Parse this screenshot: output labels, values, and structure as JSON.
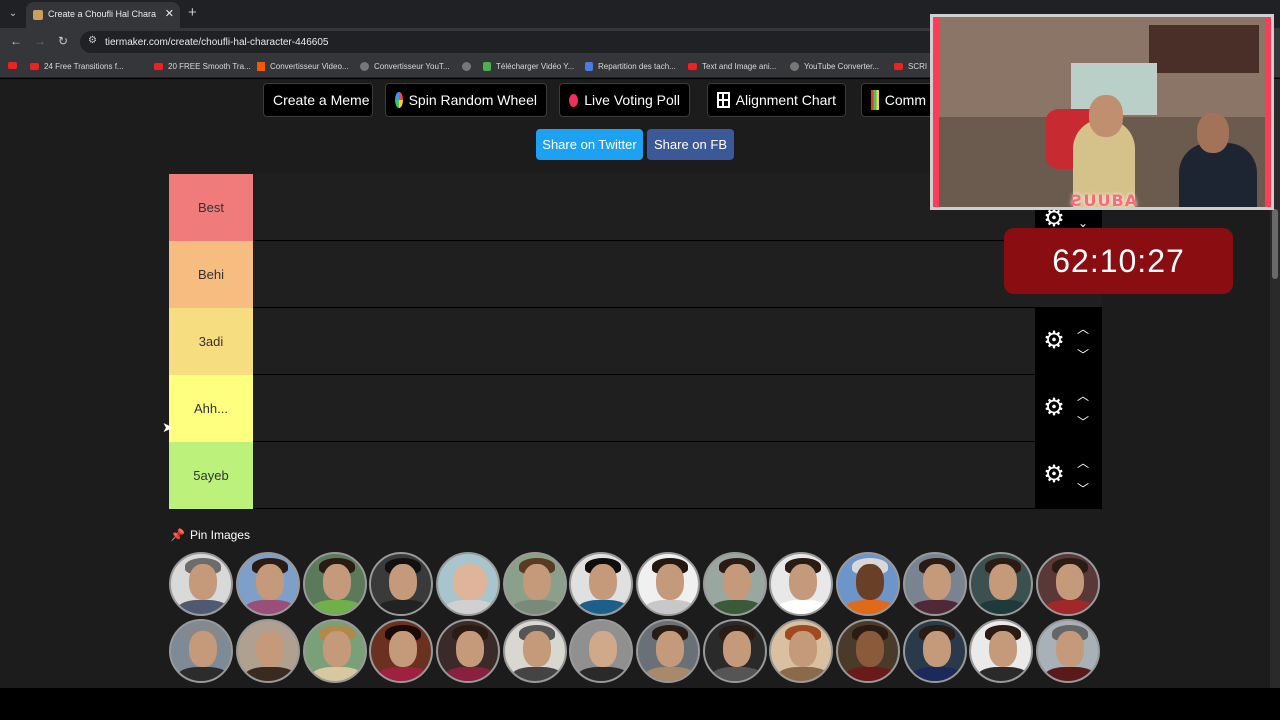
{
  "browser": {
    "tab_title": "Create a Choufli Hal Character",
    "tab_close": "✕",
    "new_tab": "+",
    "url": "tiermaker.com/create/choufli-hal-character-446605",
    "bookmarks": [
      {
        "label": "24 Free Transitions f...",
        "icon": "youtube"
      },
      {
        "label": "20 FREE Smooth Tra...",
        "icon": "youtube"
      },
      {
        "label": "Convertisseur Video...",
        "icon": "z"
      },
      {
        "label": "Convertisseur YouT...",
        "icon": "youtube"
      },
      {
        "label": "",
        "icon": "globe"
      },
      {
        "label": "Télécharger Vidéo Y...",
        "icon": "download"
      },
      {
        "label": "Repartition des tach...",
        "icon": "doc"
      },
      {
        "label": "Text and Image ani...",
        "icon": "youtube"
      },
      {
        "label": "YouTube Converter...",
        "icon": "globe"
      },
      {
        "label": "SCRI",
        "icon": "youtube"
      }
    ]
  },
  "actions": {
    "create_meme": "Create a Meme",
    "spin_wheel": "Spin Random Wheel",
    "live_poll": "Live Voting Poll",
    "alignment_chart": "Alignment Chart",
    "community": "Comm",
    "share_twitter": "Share on Twitter",
    "share_fb": "Share on FB"
  },
  "tiers": [
    {
      "label": "Best",
      "color": "#f07b7b"
    },
    {
      "label": "Behi",
      "color": "#f7bc7f"
    },
    {
      "label": "3adi",
      "color": "#f6de80"
    },
    {
      "label": "Ahh...",
      "color": "#fefe7f"
    },
    {
      "label": "5ayeb",
      "color": "#bcf17c"
    }
  ],
  "pin_images": {
    "title": "Pin Images"
  },
  "overlay": {
    "timer": "62:10:27",
    "webcam_brand": "ƧUUBA"
  },
  "colors": {
    "twitter": "#1da1f2",
    "facebook": "#3b5998",
    "timer_bg": "#8a0d12"
  }
}
